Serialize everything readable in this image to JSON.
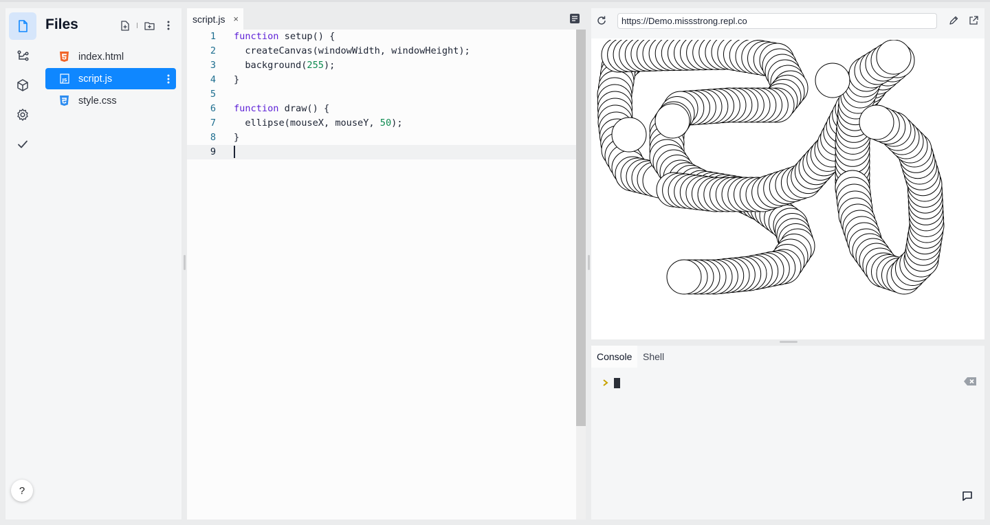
{
  "rail": {
    "items": [
      {
        "name": "files",
        "icon": "file-icon",
        "active": true
      },
      {
        "name": "version-control",
        "icon": "git-branch-icon",
        "active": false
      },
      {
        "name": "packages",
        "icon": "package-icon",
        "active": false
      },
      {
        "name": "settings",
        "icon": "gear-icon",
        "active": false
      },
      {
        "name": "check",
        "icon": "check-icon",
        "active": false
      }
    ],
    "help_label": "?"
  },
  "files_panel": {
    "title": "Files",
    "actions": [
      "new-file-icon",
      "new-folder-icon",
      "more-vertical-icon"
    ],
    "files": [
      {
        "name": "index.html",
        "icon": "html5-icon",
        "color": "#f16529",
        "selected": false
      },
      {
        "name": "script.js",
        "icon": "js-icon",
        "color": "#ffffff",
        "selected": true
      },
      {
        "name": "style.css",
        "icon": "css3-icon",
        "color": "#2d8cf0",
        "selected": false
      }
    ]
  },
  "editor": {
    "tab_label": "script.js",
    "tab_close": "×",
    "lines": [
      {
        "n": "1",
        "text": "function setup() {"
      },
      {
        "n": "2",
        "text": "  createCanvas(windowWidth, windowHeight);"
      },
      {
        "n": "3",
        "text": "  background(255);"
      },
      {
        "n": "4",
        "text": "}"
      },
      {
        "n": "5",
        "text": ""
      },
      {
        "n": "6",
        "text": "function draw() {"
      },
      {
        "n": "7",
        "text": "  ellipse(mouseX, mouseY, 50);"
      },
      {
        "n": "8",
        "text": "}"
      },
      {
        "n": "9",
        "text": ""
      }
    ],
    "current_line": "9"
  },
  "preview": {
    "url": "https://Demo.missstrong.repl.co"
  },
  "console": {
    "tabs": [
      "Console",
      "Shell"
    ],
    "active_tab": "Console"
  },
  "colors": {
    "accent": "#0f87ff",
    "keyword": "#5c1fd6",
    "number": "#0c8a4f",
    "line_number": "#1e6e8f"
  }
}
